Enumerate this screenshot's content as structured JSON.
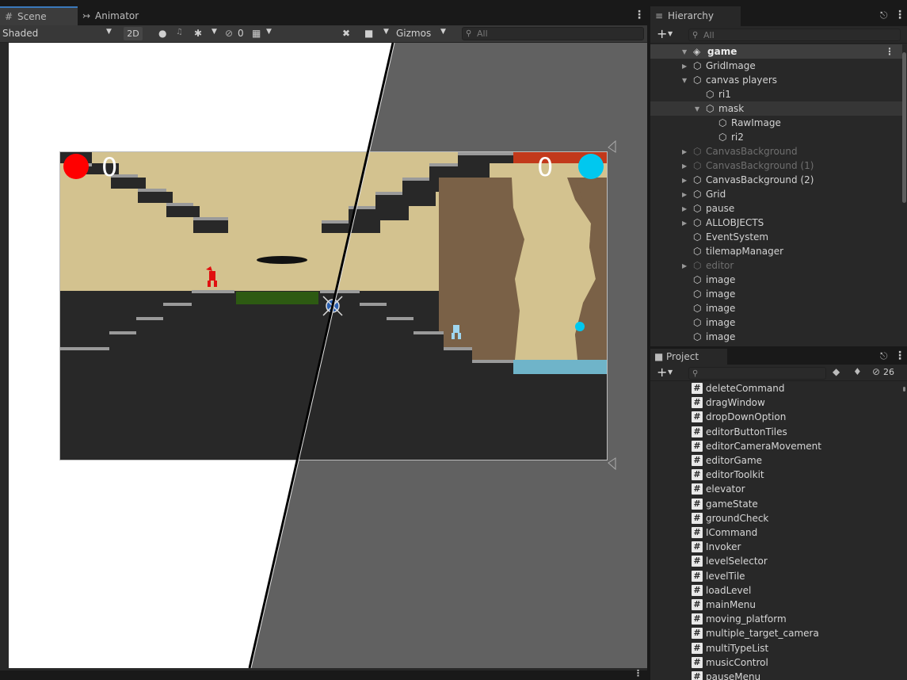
{
  "scene": {
    "tabs": [
      {
        "label": "Scene",
        "icon": "grid-icon"
      },
      {
        "label": "Animator",
        "icon": "animator-icon"
      }
    ],
    "toolbar": {
      "draw_mode": "Shaded",
      "mode_2d": "2D",
      "hidden_count": "0",
      "gizmos": "Gizmos",
      "search_placeholder": "All"
    },
    "game": {
      "score_left": "0",
      "score_right": "0",
      "colors": {
        "sand": "#d3c28f",
        "ground": "#282828",
        "stone": "#9a9a9a",
        "grass": "#2d5a12",
        "earth": "#7a6147",
        "water": "#6fb4c9",
        "lava": "#c2391b",
        "red_player": "#ff0000",
        "blue_player": "#00c8ef"
      }
    }
  },
  "hierarchy": {
    "tab_label": "Hierarchy",
    "search_placeholder": "All",
    "scene_name": "game",
    "items": [
      {
        "label": "GridImage",
        "depth": 1,
        "arrow": "right",
        "dim": false
      },
      {
        "label": "canvas players",
        "depth": 1,
        "arrow": "down",
        "dim": false
      },
      {
        "label": "ri1",
        "depth": 2,
        "arrow": "",
        "dim": false
      },
      {
        "label": "mask",
        "depth": 2,
        "arrow": "down",
        "dim": false,
        "selected": true
      },
      {
        "label": "RawImage",
        "depth": 3,
        "arrow": "",
        "dim": false
      },
      {
        "label": "ri2",
        "depth": 3,
        "arrow": "",
        "dim": false
      },
      {
        "label": "CanvasBackground",
        "depth": 1,
        "arrow": "right",
        "dim": true
      },
      {
        "label": "CanvasBackground (1)",
        "depth": 1,
        "arrow": "right",
        "dim": true
      },
      {
        "label": "CanvasBackground (2)",
        "depth": 1,
        "arrow": "right",
        "dim": false
      },
      {
        "label": "Grid",
        "depth": 1,
        "arrow": "right",
        "dim": false
      },
      {
        "label": "pause",
        "depth": 1,
        "arrow": "right",
        "dim": false
      },
      {
        "label": "ALLOBJECTS",
        "depth": 1,
        "arrow": "right",
        "dim": false
      },
      {
        "label": "EventSystem",
        "depth": 1,
        "arrow": "",
        "dim": false
      },
      {
        "label": "tilemapManager",
        "depth": 1,
        "arrow": "",
        "dim": false
      },
      {
        "label": "editor",
        "depth": 1,
        "arrow": "right",
        "dim": true
      },
      {
        "label": "image",
        "depth": 1,
        "arrow": "",
        "dim": false
      },
      {
        "label": "image",
        "depth": 1,
        "arrow": "",
        "dim": false
      },
      {
        "label": "image",
        "depth": 1,
        "arrow": "",
        "dim": false
      },
      {
        "label": "image",
        "depth": 1,
        "arrow": "",
        "dim": false
      },
      {
        "label": "image",
        "depth": 1,
        "arrow": "",
        "dim": false
      }
    ]
  },
  "project": {
    "tab_label": "Project",
    "hidden_count": "26",
    "scripts": [
      "deleteCommand",
      "dragWindow",
      "dropDownOption",
      "editorButtonTiles",
      "editorCameraMovement",
      "editorGame",
      "editorToolkit",
      "elevator",
      "gameState",
      "groundCheck",
      "ICommand",
      "Invoker",
      "levelSelector",
      "levelTile",
      "loadLevel",
      "mainMenu",
      "moving_platform",
      "multiple_target_camera",
      "multiTypeList",
      "musicControl",
      "pauseMenu"
    ]
  }
}
